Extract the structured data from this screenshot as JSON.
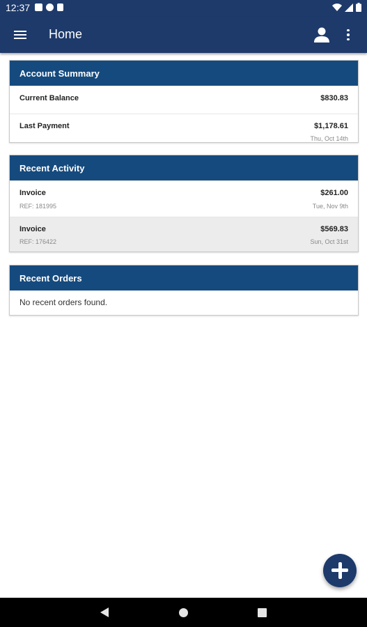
{
  "status_bar": {
    "time": "12:37",
    "left_icons": [
      "sim-icon",
      "cast-icon",
      "sd-card-icon"
    ],
    "right_icons": [
      "wifi-icon",
      "signal-icon",
      "battery-icon"
    ]
  },
  "app_bar": {
    "title": "Home",
    "icons": [
      "menu-icon",
      "account-icon",
      "more-vert-icon"
    ]
  },
  "account_summary": {
    "title": "Account Summary",
    "current_balance_label": "Current Balance",
    "current_balance_value": "$830.83",
    "last_payment_label": "Last Payment",
    "last_payment_value": "$1,178.61",
    "last_payment_date": "Thu, Oct 14th"
  },
  "recent_activity": {
    "title": "Recent Activity",
    "items": [
      {
        "type": "Invoice",
        "ref": "REF: 181995",
        "amount": "$261.00",
        "date": "Tue, Nov 9th"
      },
      {
        "type": "Invoice",
        "ref": "REF: 176422",
        "amount": "$569.83",
        "date": "Sun, Oct 31st"
      }
    ]
  },
  "recent_orders": {
    "title": "Recent Orders",
    "empty_message": "No recent orders found."
  },
  "fab": {
    "icon": "add-icon"
  },
  "nav_bar": {
    "icons": [
      "back-icon",
      "home-icon",
      "recents-icon"
    ]
  },
  "colors": {
    "app_bar": "#1e3a6b",
    "card_header": "#154a7e",
    "alt_row": "#ececec"
  }
}
